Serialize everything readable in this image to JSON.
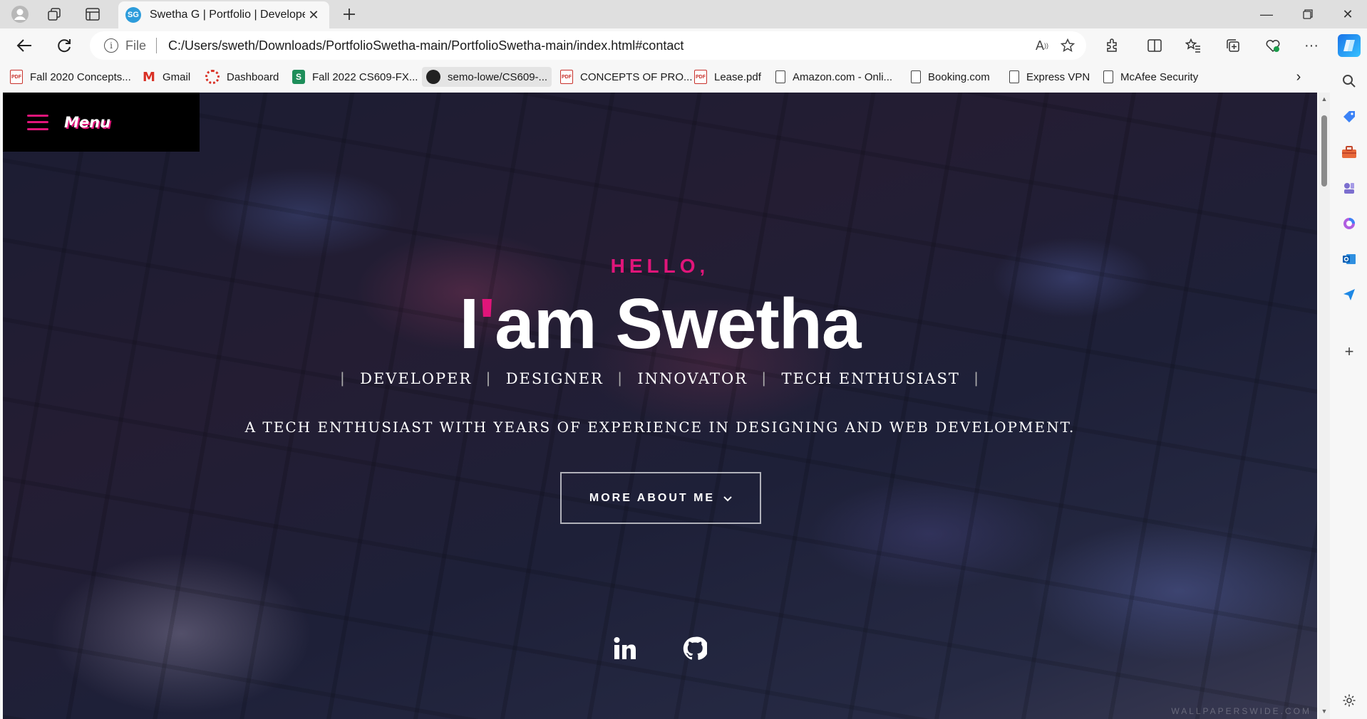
{
  "browser": {
    "tab": {
      "favicon_text": "SG",
      "title": "Swetha G | Portfolio | Developer"
    },
    "address": {
      "scheme_label": "File",
      "url": "C:/Users/sweth/Downloads/PortfolioSwetha-main/PortfolioSwetha-main/index.html#contact"
    },
    "bookmarks": [
      {
        "label": "Fall 2020 Concepts...",
        "icon": "pdf-icon"
      },
      {
        "label": "Gmail",
        "icon": "gmail-icon"
      },
      {
        "label": "Dashboard",
        "icon": "dashboard-icon"
      },
      {
        "label": "Fall 2022 CS609-FX...",
        "icon": "sharepoint-icon"
      },
      {
        "label": "semo-lowe/CS609-...",
        "icon": "github-icon"
      },
      {
        "label": "CONCEPTS OF PRO...",
        "icon": "pdf-icon"
      },
      {
        "label": "Lease.pdf",
        "icon": "pdf-icon"
      },
      {
        "label": "Amazon.com - Onli...",
        "icon": "page-icon"
      },
      {
        "label": "Booking.com",
        "icon": "page-icon"
      },
      {
        "label": "Express VPN",
        "icon": "page-icon"
      },
      {
        "label": "McAfee Security",
        "icon": "page-icon"
      }
    ],
    "pdf_badge": "PDF"
  },
  "page": {
    "menu_label": "Menu",
    "hello": "HELLO,",
    "name_prefix": "I",
    "name_tick": "'",
    "name_rest": "am Swetha",
    "roles": [
      "DEVELOPER",
      "DESIGNER",
      "INNOVATOR",
      "TECH ENTHUSIAST"
    ],
    "role_separator": "|",
    "tagline": "A TECH ENTHUSIAST WITH YEARS OF EXPERIENCE IN DESIGNING AND WEB DEVELOPMENT.",
    "more_button": "MORE ABOUT ME",
    "socials": [
      "linkedin-icon",
      "github-icon"
    ],
    "watermark": "WALLPAPERSWIDE.COM"
  },
  "colors": {
    "accent": "#e0157a",
    "menu_bg": "#000000",
    "text": "#ffffff"
  }
}
